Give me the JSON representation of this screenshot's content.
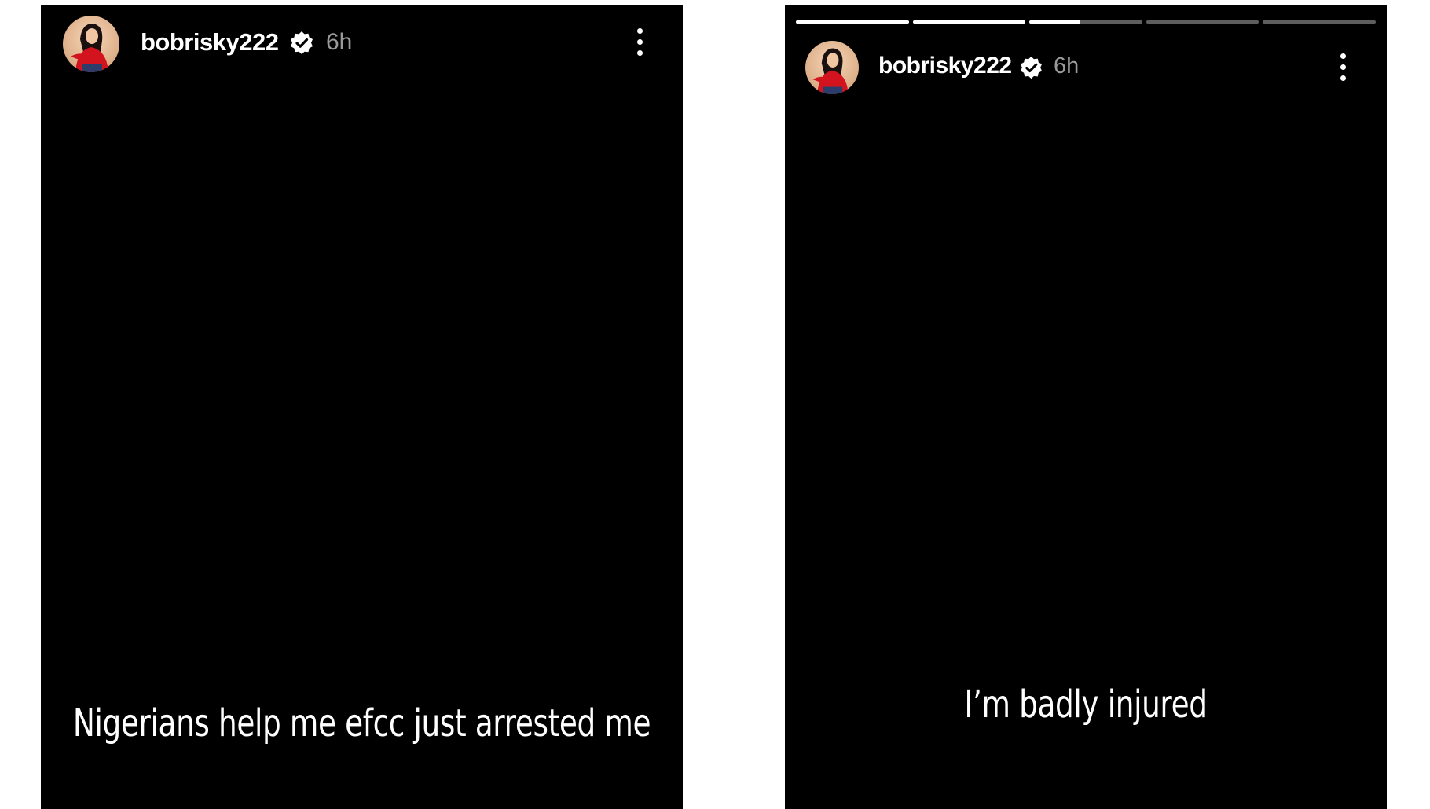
{
  "stories": [
    {
      "username": "bobrisky222",
      "time": "6h",
      "verified": true,
      "caption": "Nigerians help me efcc just arrested me"
    },
    {
      "username": "bobrisky222",
      "time": "6h",
      "verified": true,
      "caption": "I’m badly injured",
      "progress": [
        1,
        1,
        0.45,
        0,
        0
      ]
    }
  ],
  "colors": {
    "story_background": "#000000",
    "page_background": "#ffffff",
    "text": "#ffffff",
    "time": "#9a9a9a",
    "progress_track": "#5e5e5e",
    "progress_fill": "#ffffff"
  },
  "icons": [
    "avatar",
    "verified-badge-icon",
    "more-options-icon"
  ]
}
